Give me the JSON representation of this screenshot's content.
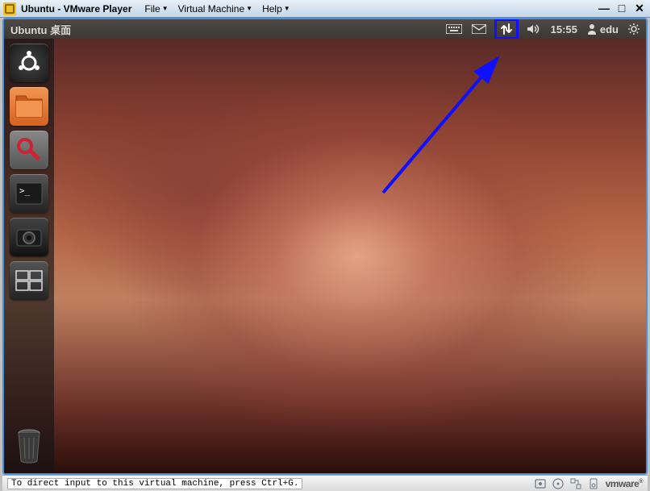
{
  "vmware": {
    "title": "Ubuntu - VMware Player",
    "menu": {
      "file": "File",
      "vm": "Virtual Machine",
      "help": "Help"
    }
  },
  "ubuntu": {
    "topbar_title": "Ubuntu 桌面",
    "time": "15:55",
    "user": "edu"
  },
  "launcher": {
    "dash": "Dash Home",
    "files": "Files",
    "settings": "System Settings",
    "terminal": "Terminal",
    "camera": "Camera",
    "switcher": "Workspace Switcher",
    "trash": "Trash"
  },
  "statusbar": {
    "hint": "To direct input to this virtual machine, press Ctrl+G.",
    "brand": "vmware"
  },
  "annotation": {
    "highlighted": "network-indicator"
  }
}
